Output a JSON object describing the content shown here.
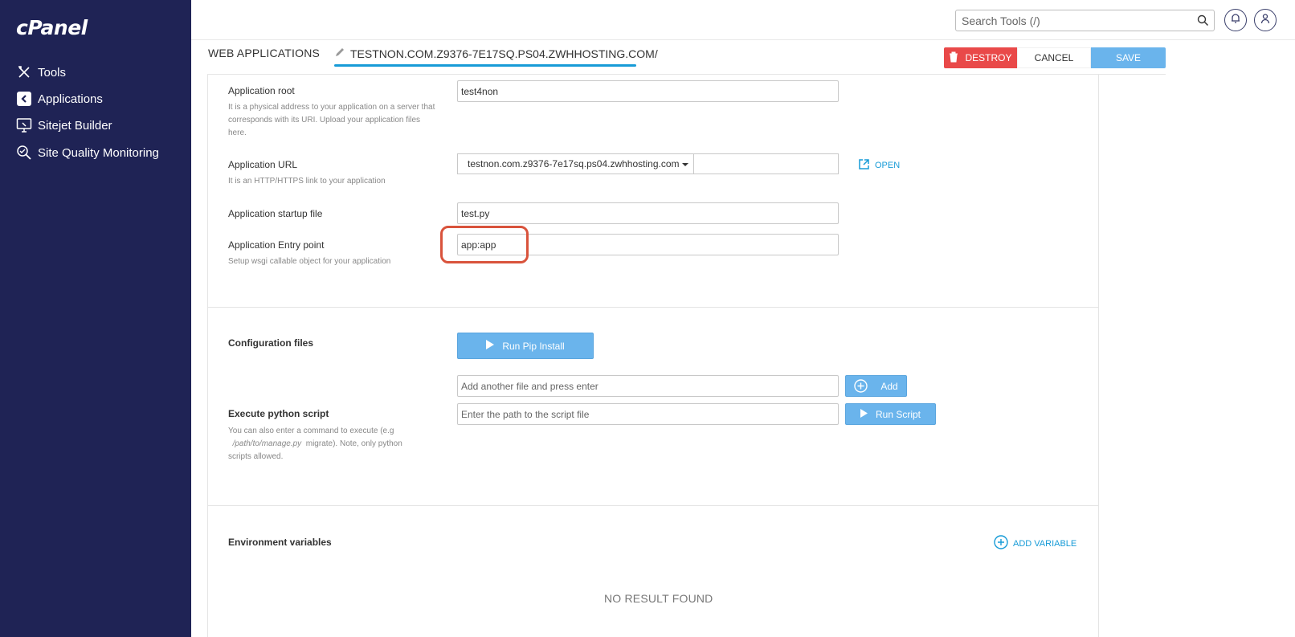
{
  "sidebar": {
    "logo": "cPanel",
    "items": [
      {
        "label": "Tools",
        "icon": "tools-icon"
      },
      {
        "label": "Applications",
        "icon": "applications-icon"
      },
      {
        "label": "Sitejet Builder",
        "icon": "sitejet-icon"
      },
      {
        "label": "Site Quality Monitoring",
        "icon": "site-quality-icon"
      }
    ]
  },
  "topbar": {
    "search_placeholder": "Search Tools (/)"
  },
  "header": {
    "title": "WEB APPLICATIONS",
    "app_tab": "TESTNON.COM.Z9376-7E17SQ.PS04.ZWHHOSTING.COM/",
    "destroy_label": "DESTROY",
    "cancel_label": "CANCEL",
    "save_label": "SAVE"
  },
  "form": {
    "app_root": {
      "label": "Application root",
      "hint": "It is a physical address to your application on a server that corresponds with its URI. Upload your application files here.",
      "value": "test4non"
    },
    "app_url": {
      "label": "Application URL",
      "hint": "It is an HTTP/HTTPS link to your application",
      "domain": "testnon.com.z9376-7e17sq.ps04.zwhhosting.com",
      "path": "",
      "open_label": "OPEN"
    },
    "startup_file": {
      "label": "Application startup file",
      "value": "test.py"
    },
    "entry_point": {
      "label": "Application Entry point",
      "hint": "Setup wsgi callable object for your application",
      "value": "app:app"
    }
  },
  "config": {
    "label": "Configuration files",
    "run_pip_label": "Run Pip Install",
    "add_file_placeholder": "Add another file and press enter",
    "add_label": "Add"
  },
  "script": {
    "label": "Execute python script",
    "hint_prefix": "You can also enter a command to execute (e.g",
    "hint_path": "/path/to/manage.py",
    "hint_suffix": "migrate). Note, only python scripts allowed.",
    "placeholder": "Enter the path to the script file",
    "run_label": "Run Script"
  },
  "env": {
    "label": "Environment variables",
    "add_label": "ADD VARIABLE",
    "empty_text": "NO RESULT FOUND"
  },
  "colors": {
    "sidebar_bg": "#1f2355",
    "accent_blue": "#179bd7",
    "button_blue": "#6ab4ec",
    "destroy_red": "#e94949",
    "highlight_ring": "#d9533c"
  }
}
